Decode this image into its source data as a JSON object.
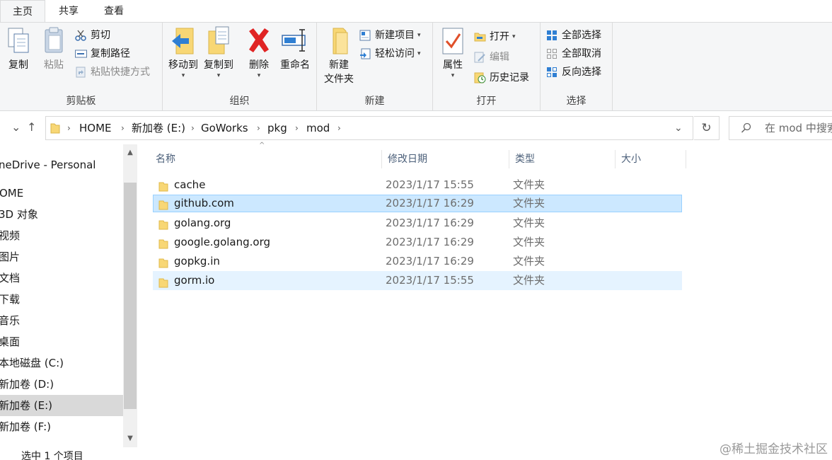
{
  "ribbon": {
    "tabs": [
      "主页",
      "共享",
      "查看"
    ],
    "clipboard": {
      "label": "剪贴板",
      "copy": "复制",
      "paste": "粘贴",
      "cut": "剪切",
      "copy_path": "复制路径",
      "paste_shortcut": "粘贴快捷方式"
    },
    "organize": {
      "label": "组织",
      "move_to": "移动到",
      "copy_to": "复制到",
      "delete": "删除",
      "rename": "重命名"
    },
    "new": {
      "label": "新建",
      "new_folder_line1": "新建",
      "new_folder_line2": "文件夹",
      "new_item": "新建项目",
      "easy_access": "轻松访问"
    },
    "open": {
      "label": "打开",
      "properties": "属性",
      "open": "打开",
      "edit": "编辑",
      "history": "历史记录"
    },
    "select": {
      "label": "选择",
      "select_all": "全部选择",
      "select_none": "全部取消",
      "invert": "反向选择"
    }
  },
  "address": {
    "crumbs": [
      "HOME",
      "新加卷 (E:)",
      "GoWorks",
      "pkg",
      "mod"
    ]
  },
  "search": {
    "placeholder": "在 mod 中搜索"
  },
  "nav": {
    "items": [
      "neDrive - Personal",
      "OME",
      "3D 对象",
      "视频",
      "图片",
      "文档",
      "下载",
      "音乐",
      "桌面",
      "本地磁盘 (C:)",
      "新加卷 (D:)",
      "新加卷 (E:)",
      "新加卷 (F:)"
    ]
  },
  "columns": {
    "name": "名称",
    "date": "修改日期",
    "type": "类型",
    "size": "大小"
  },
  "files": [
    {
      "name": "cache",
      "date": "2023/1/17 15:55",
      "type": "文件夹"
    },
    {
      "name": "github.com",
      "date": "2023/1/17 16:29",
      "type": "文件夹"
    },
    {
      "name": "golang.org",
      "date": "2023/1/17 16:29",
      "type": "文件夹"
    },
    {
      "name": "google.golang.org",
      "date": "2023/1/17 16:29",
      "type": "文件夹"
    },
    {
      "name": "gopkg.in",
      "date": "2023/1/17 16:29",
      "type": "文件夹"
    },
    {
      "name": "gorm.io",
      "date": "2023/1/17 15:55",
      "type": "文件夹"
    }
  ],
  "status": {
    "left": "",
    "selection": "选中 1 个项目"
  },
  "watermark": "@稀土掘金技术社区",
  "colors": {
    "accent": "#0063b1",
    "selection": "#cce8ff",
    "folder": "#f8d775"
  }
}
